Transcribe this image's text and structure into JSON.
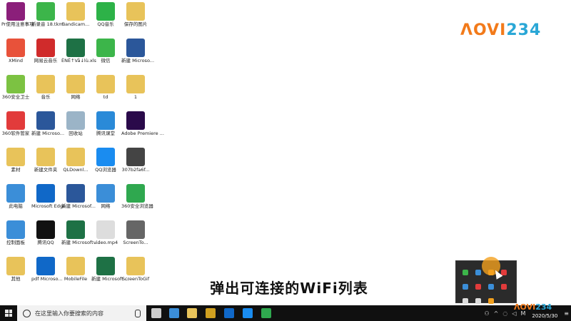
{
  "logo": {
    "text_a": "ΛOVI",
    "text_b": "234"
  },
  "subtitle": "弹出可连接的WiFi列表",
  "taskbar": {
    "search_placeholder": "在这里输入你要搜索的内容",
    "date": "2020/5/30",
    "ime": "M",
    "action_center": "≡"
  },
  "desktop_icons": [
    {
      "label": "Pr使用注意事项",
      "icon": "winrar-icon",
      "color": "#8b1f7a"
    },
    {
      "label": "新录音 18.tkm",
      "icon": "music-note-icon",
      "color": "#3cb54a"
    },
    {
      "label": "Bandicam...",
      "icon": "folder-icon",
      "color": "#e8c35a"
    },
    {
      "label": "QQ音乐",
      "icon": "qq-music-icon",
      "color": "#2db248"
    },
    {
      "label": "保存的图片",
      "icon": "folder-icon",
      "color": "#e8c35a"
    },
    {
      "label": "XMind",
      "icon": "xmind-icon",
      "color": "#e8523a"
    },
    {
      "label": "网易云音乐",
      "icon": "netease-music-icon",
      "color": "#d02b2b"
    },
    {
      "label": "ÈNÈ↑Vå↓lù.xls",
      "icon": "excel-icon",
      "color": "#1e7145"
    },
    {
      "label": "微信",
      "icon": "wechat-icon",
      "color": "#3cb54a"
    },
    {
      "label": "新建 Microso...",
      "icon": "word-icon",
      "color": "#2b579a"
    },
    {
      "label": "360安全卫士",
      "icon": "360-security-icon",
      "color": "#7cc242"
    },
    {
      "label": "音乐",
      "icon": "folder-icon",
      "color": "#e8c35a"
    },
    {
      "label": "网络",
      "icon": "folder-icon",
      "color": "#e8c35a"
    },
    {
      "label": "td",
      "icon": "folder-icon",
      "color": "#e8c35a"
    },
    {
      "label": "1",
      "icon": "folder-icon",
      "color": "#e8c35a"
    },
    {
      "label": "360软件管家",
      "icon": "360-software-icon",
      "color": "#e23b3b"
    },
    {
      "label": "新建 Microso...",
      "icon": "word-icon",
      "color": "#2b579a"
    },
    {
      "label": "回收站",
      "icon": "recycle-bin-icon",
      "color": "#9bb4c7"
    },
    {
      "label": "腾讯课堂",
      "icon": "tencent-class-icon",
      "color": "#2a8ad8"
    },
    {
      "label": "Adobe Premiere ...",
      "icon": "premiere-icon",
      "color": "#2a0a4a"
    },
    {
      "label": "素材",
      "icon": "folder-icon",
      "color": "#e8c35a"
    },
    {
      "label": "新建文件夹",
      "icon": "folder-icon",
      "color": "#e8c35a"
    },
    {
      "label": "QLDownl...",
      "icon": "folder-icon",
      "color": "#e8c35a"
    },
    {
      "label": "QQ浏览器",
      "icon": "qq-browser-icon",
      "color": "#1a8cf0"
    },
    {
      "label": "307b2fa6f...",
      "icon": "media-file-icon",
      "color": "#444444"
    },
    {
      "label": "此电脑",
      "icon": "computer-icon",
      "color": "#3b8ed8"
    },
    {
      "label": "Microsoft Edge",
      "icon": "edge-icon",
      "color": "#1068c8"
    },
    {
      "label": "新建 Microsof...",
      "icon": "word-icon",
      "color": "#2b579a"
    },
    {
      "label": "网络",
      "icon": "network-icon",
      "color": "#3b8ed8"
    },
    {
      "label": "360安全浏览器",
      "icon": "360-browser-icon",
      "color": "#2fa84f"
    },
    {
      "label": "控制面板",
      "icon": "control-panel-icon",
      "color": "#3b8ed8"
    },
    {
      "label": "腾讯QQ",
      "icon": "qq-icon",
      "color": "#111111"
    },
    {
      "label": "新建 Microsoft ...",
      "icon": "excel-icon",
      "color": "#1e7145"
    },
    {
      "label": "video.mp4",
      "icon": "video-file-icon",
      "color": "#dddddd"
    },
    {
      "label": "ScreenTo...",
      "icon": "screentogif-icon",
      "color": "#666666"
    },
    {
      "label": "其他",
      "icon": "folder-icon",
      "color": "#e8c35a"
    },
    {
      "label": "pdf Microso...",
      "icon": "edge-pdf-icon",
      "color": "#1068c8"
    },
    {
      "label": "MobileFile",
      "icon": "folder-icon",
      "color": "#e8c35a"
    },
    {
      "label": "新建 Microsoft ...",
      "icon": "excel-icon",
      "color": "#1e7145"
    },
    {
      "label": "ScreenToGif",
      "icon": "folder-icon",
      "color": "#e8c35a"
    }
  ],
  "taskbar_apps": [
    {
      "icon": "task-view-icon",
      "color": "#cccccc"
    },
    {
      "icon": "mail-icon",
      "color": "#3b8ed8"
    },
    {
      "icon": "file-explorer-icon",
      "color": "#e8c35a"
    },
    {
      "icon": "store-icon",
      "color": "#d0a020"
    },
    {
      "icon": "edge-icon",
      "color": "#1068c8"
    },
    {
      "icon": "qq-browser-icon",
      "color": "#1a8cf0"
    },
    {
      "icon": "360-browser-icon",
      "color": "#2fa84f"
    }
  ],
  "tray_popup_items": [
    {
      "icon": "tray-app-green-icon",
      "color": "#3cb54a"
    },
    {
      "icon": "tray-app-blue-icon",
      "color": "#3b8ed8"
    },
    {
      "icon": "wifi-app-icon",
      "color": "#f2a01e"
    },
    {
      "icon": "sogou-icon",
      "color": "#e23b3b"
    },
    {
      "icon": "bluetooth-icon",
      "color": "#3b8ed8"
    },
    {
      "icon": "tray-red-icon",
      "color": "#e23b3b"
    },
    {
      "icon": "wps-icon",
      "color": "#3b8ed8"
    },
    {
      "icon": "record-icon",
      "color": "#e23b3b"
    },
    {
      "icon": "volume-icon",
      "color": "#dddddd"
    },
    {
      "icon": "battery-icon",
      "color": "#dddddd"
    },
    {
      "icon": "tray-app-small-icon",
      "color": "#f2a01e"
    }
  ]
}
